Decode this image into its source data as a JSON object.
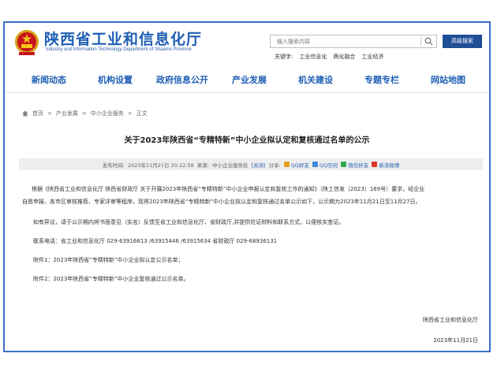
{
  "header": {
    "title": "陕西省工业和信息化厅",
    "subtitle": "Industry and Information Technology Department of Shaanxi Province",
    "search_placeholder": "输入搜索内容",
    "advanced_search": "高级搜索",
    "keywords_label": "关键字:",
    "keywords": [
      "工业信息化",
      "两化融合",
      "工业经济"
    ]
  },
  "nav": {
    "items": [
      "新闻动态",
      "机构设置",
      "政府信息公开",
      "产业发展",
      "机关建设",
      "专题专栏",
      "网站地图"
    ]
  },
  "breadcrumb": {
    "items": [
      "首页",
      "产业发展",
      "中小企业服务",
      "正文"
    ],
    "separator": ">"
  },
  "article": {
    "title": "关于2023年陕西省“专精特新”中小企业拟认定和复核通过名单的公示",
    "meta": {
      "published_label": "发布时间:",
      "published": "2023年11月21日 20:22:58",
      "source_label": "来源:",
      "source": "中小企业服务处",
      "close": "[关闭]",
      "share_label": "分享:",
      "share": [
        "QQ好友",
        "QQ空间",
        "微信好友",
        "新浪微博"
      ]
    },
    "paragraphs": [
      "根据《陕西省工业和信息化厅 陕西省财政厅 关于开展2023年陕西省“专精特新”中小企业申报认定和复核工作的通知》（陕工信发（2023）169号）要求，经企业",
      "自愿申报、各市区审核推荐、专家评审等程序，现将2023年陕西省“专精特新”中小企业拟认定和复核通过名单公示如下，公示期为2023年11月21日至11月27日。",
      "如有异议，请于公示期内将书面意见（实名）反馈至省工业和信息化厅、省财政厅,并提供佐证材料和联系方式，以便核实查证。",
      "联系电话：省工业和信息化厅  029-63916813 /63915446 /63915634   省财政厅  029-68936131",
      "附件1：2023年陕西省“专精特新”中小企业拟认定公示名单；",
      "附件2：2023年陕西省“专精特新”中小企业复核通过公示名单。"
    ],
    "signature_org": "陕西省工业和信息化厅",
    "signature_date": "2023年11月21日"
  },
  "colors": {
    "frame": "#3b6fc4",
    "brand_blue": "#1f5fb4",
    "button_blue": "#1f4e96"
  }
}
